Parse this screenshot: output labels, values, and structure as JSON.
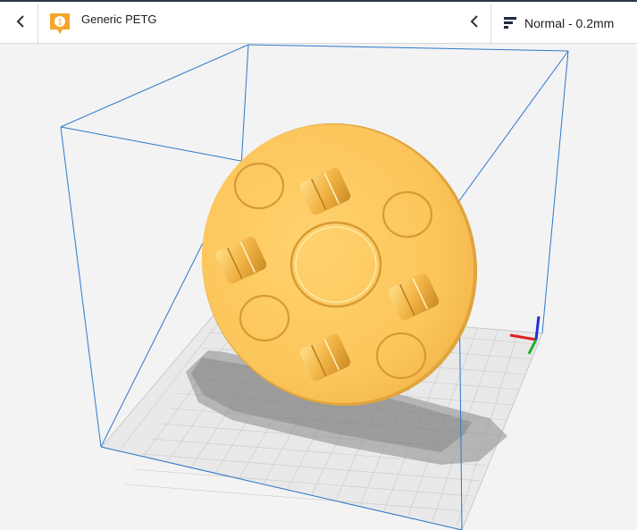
{
  "header": {
    "material": {
      "extruder_number": "1",
      "name": "Generic PETG",
      "badge_color": "#f2a62b"
    },
    "profile": {
      "name": "Normal - 0.2mm"
    }
  },
  "icons": {
    "left_back": "chevron-left-icon",
    "material_collapse": "chevron-left-icon",
    "profile": "print-settings-icon",
    "extruder": "extruder-badge-icon"
  },
  "scene": {
    "model_color": "#fbc85e",
    "build_volume_color": "#2a79c9",
    "axis_colors": {
      "x": "#e02020",
      "y": "#1fae2f",
      "z": "#1a33d6"
    }
  }
}
